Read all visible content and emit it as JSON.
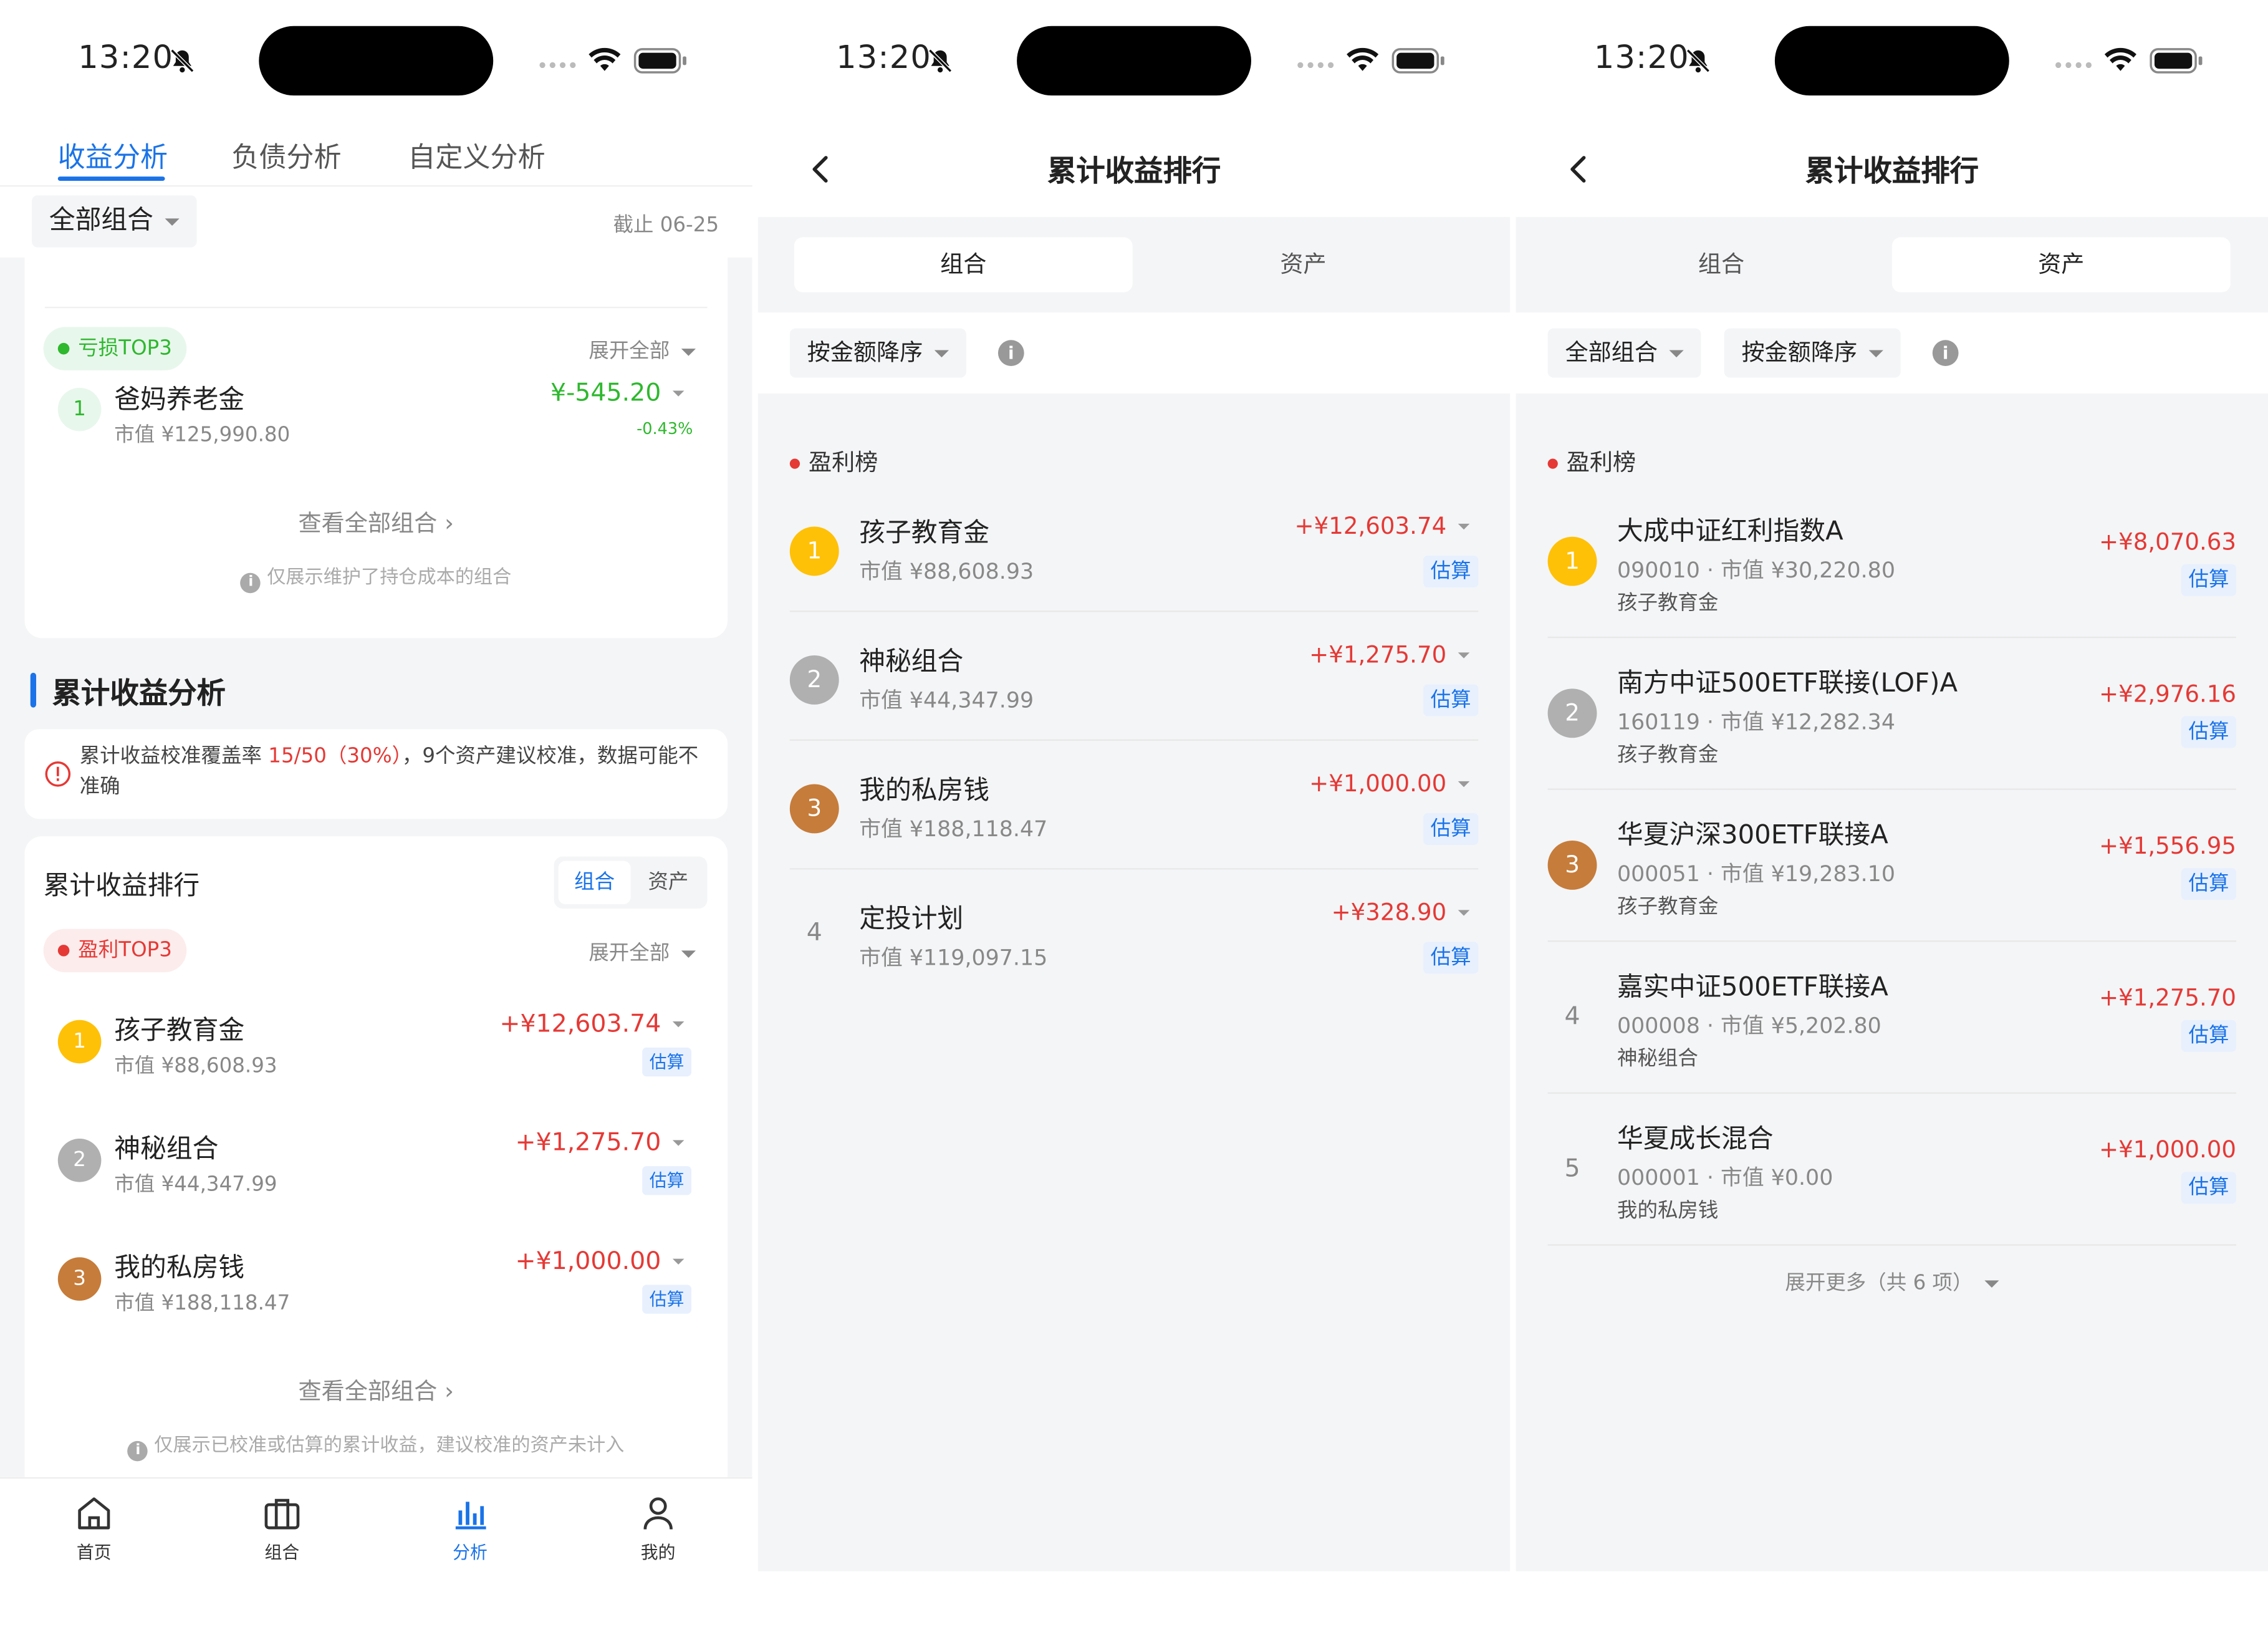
{
  "status": {
    "time": "13:20"
  },
  "p1": {
    "tabs": [
      "收益分析",
      "负债分析",
      "自定义分析"
    ],
    "filter": "全部组合",
    "as_of": "截止 06-25",
    "loss": {
      "tag": "亏损TOP3",
      "expand": "展开全部",
      "items": [
        {
          "rank": "1",
          "name": "爸妈养老金",
          "sub": "市值 ¥125,990.80",
          "amount": "¥-545.20",
          "pct": "-0.43%"
        }
      ],
      "link": "查看全部组合",
      "note": "仅展示维护了持仓成本的组合"
    },
    "section_title": "累计收益分析",
    "warning": {
      "pre": "累计收益校准覆盖率 ",
      "ratio": "15/50（30%）",
      "post": "，9个资产建议校准，数据可能不准确"
    },
    "ranking": {
      "title": "累计收益排行",
      "toggle": [
        "组合",
        "资产"
      ],
      "tag": "盈利TOP3",
      "expand": "展开全部",
      "items": [
        {
          "rank": "1",
          "name": "孩子教育金",
          "sub": "市值 ¥88,608.93",
          "amount": "+¥12,603.74",
          "badge": "估算"
        },
        {
          "rank": "2",
          "name": "神秘组合",
          "sub": "市值 ¥44,347.99",
          "amount": "+¥1,275.70",
          "badge": "估算"
        },
        {
          "rank": "3",
          "name": "我的私房钱",
          "sub": "市值 ¥188,118.47",
          "amount": "+¥1,000.00",
          "badge": "估算"
        }
      ],
      "link": "查看全部组合",
      "note": "仅展示已校准或估算的累计收益，建议校准的资产未计入"
    },
    "tabbar": [
      {
        "label": "首页",
        "icon": "home-icon"
      },
      {
        "label": "组合",
        "icon": "briefcase-icon"
      },
      {
        "label": "分析",
        "icon": "chart-icon"
      },
      {
        "label": "我的",
        "icon": "user-icon"
      }
    ],
    "active_tab": "分析"
  },
  "p2": {
    "title": "累计收益排行",
    "segments": [
      "组合",
      "资产"
    ],
    "active_segment": "组合",
    "sort": "按金额降序",
    "board": "盈利榜",
    "items": [
      {
        "rank": "1",
        "name": "孩子教育金",
        "sub": "市值 ¥88,608.93",
        "amount": "+¥12,603.74",
        "badge": "估算"
      },
      {
        "rank": "2",
        "name": "神秘组合",
        "sub": "市值 ¥44,347.99",
        "amount": "+¥1,275.70",
        "badge": "估算"
      },
      {
        "rank": "3",
        "name": "我的私房钱",
        "sub": "市值 ¥188,118.47",
        "amount": "+¥1,000.00",
        "badge": "估算"
      },
      {
        "rank": "4",
        "name": "定投计划",
        "sub": "市值 ¥119,097.15",
        "amount": "+¥328.90",
        "badge": "估算"
      }
    ]
  },
  "p3": {
    "title": "累计收益排行",
    "segments": [
      "组合",
      "资产"
    ],
    "active_segment": "资产",
    "filter": "全部组合",
    "sort": "按金额降序",
    "board": "盈利榜",
    "items": [
      {
        "rank": "1",
        "name": "大成中证红利指数A",
        "sub": "090010 · 市值 ¥30,220.80",
        "owner": "孩子教育金",
        "amount": "+¥8,070.63",
        "badge": "估算"
      },
      {
        "rank": "2",
        "name": "南方中证500ETF联接(LOF)A",
        "sub": "160119 · 市值 ¥12,282.34",
        "owner": "孩子教育金",
        "amount": "+¥2,976.16",
        "badge": "估算"
      },
      {
        "rank": "3",
        "name": "华夏沪深300ETF联接A",
        "sub": "000051 · 市值 ¥19,283.10",
        "owner": "孩子教育金",
        "amount": "+¥1,556.95",
        "badge": "估算"
      },
      {
        "rank": "4",
        "name": "嘉实中证500ETF联接A",
        "sub": "000008 · 市值 ¥5,202.80",
        "owner": "神秘组合",
        "amount": "+¥1,275.70",
        "badge": "估算"
      },
      {
        "rank": "5",
        "name": "华夏成长混合",
        "sub": "000001 · 市值 ¥0.00",
        "owner": "我的私房钱",
        "amount": "+¥1,000.00",
        "badge": "估算"
      }
    ],
    "more": "展开更多（共 6 项）"
  },
  "colors": {
    "accent": "#1a73e8",
    "gain": "#e53935",
    "loss": "#2eb82e",
    "gold": "#ffc107",
    "silver": "#b0b0b0",
    "bronze": "#c67c3a"
  }
}
